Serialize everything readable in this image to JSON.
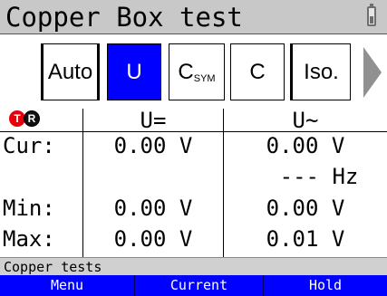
{
  "title": "Copper Box test",
  "tabs": [
    {
      "label": "Auto"
    },
    {
      "label": "U"
    },
    {
      "label": "C",
      "sub": "SYM"
    },
    {
      "label": "C"
    },
    {
      "label": "Iso."
    }
  ],
  "probes": {
    "t": "T",
    "r": "R"
  },
  "columns": {
    "dc": "U=",
    "ac": "U~"
  },
  "rows": {
    "cur": {
      "label": "Cur:",
      "dc": "0.00 V",
      "ac": "0.00 V"
    },
    "freq": {
      "ac": "--- Hz"
    },
    "min": {
      "label": "Min:",
      "dc": "0.00 V",
      "ac": "0.00 V"
    },
    "max": {
      "label": "Max:",
      "dc": "0.00 V",
      "ac": "0.01 V"
    }
  },
  "status": "Copper tests",
  "softkeys": {
    "menu": "Menu",
    "current": "Current",
    "hold": "Hold"
  },
  "colors": {
    "accent": "#0000ff",
    "probe_t": "#e8000b",
    "probe_r": "#111111",
    "title_bg": "#c8c8c8"
  },
  "icons": {
    "battery": "battery-icon",
    "next": "arrow-right-icon"
  }
}
